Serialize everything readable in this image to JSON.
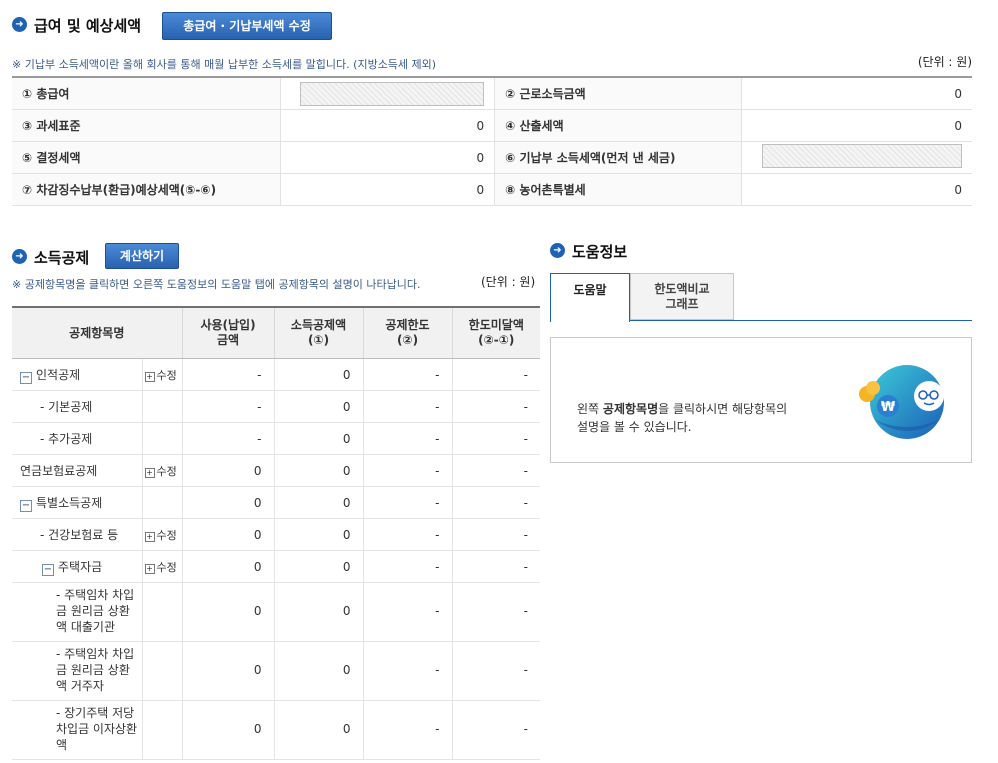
{
  "salary_section": {
    "title": "급여 및 예상세액",
    "edit_button": "총급여 · 기납부세액 수정",
    "note": "※ 기납부 소득세액이란 올해 회사를 통해 매월 납부한 소득세를 말힙니다. (지방소득세 제외)",
    "unit": "(단위 : 원)",
    "rows": [
      {
        "left_label": "① 총급여",
        "left_value": "",
        "right_label": "② 근로소득금액",
        "right_value": "0"
      },
      {
        "left_label": "③ 과세표준",
        "left_value": "0",
        "right_label": "④ 산출세액",
        "right_value": "0"
      },
      {
        "left_label": "⑤ 결정세액",
        "left_value": "0",
        "right_label": "⑥ 기납부 소득세액(먼저 낸 세금)",
        "right_value": ""
      },
      {
        "left_label": "⑦ 차감징수납부(환급)예상세액(⑤-⑥)",
        "left_value": "0",
        "right_label": "⑧ 농어촌특별세",
        "right_value": "0"
      }
    ]
  },
  "deduction_section": {
    "title": "소득공제",
    "calc_button": "계산하기",
    "note": "※ 공제항목명을 클릭하면 오른쪽 도움정보의 도움말 탭에 공제항목의 설명이 나타납니다.",
    "unit": "(단위 : 원)",
    "headers": [
      "공제항목명",
      "사용(납입)\n금액",
      "소득공제액\n(①)",
      "공제한도\n(②)",
      "한도미달액\n(②-①)"
    ],
    "edit_label": "수정",
    "rows": [
      {
        "name": "인적공제",
        "toggle": "−",
        "indent": 0,
        "edit": true,
        "use": "-",
        "ded": "0",
        "limit": "-",
        "short": "-"
      },
      {
        "name": "- 기본공제",
        "indent": 1,
        "edit": false,
        "use": "-",
        "ded": "0",
        "limit": "-",
        "short": "-"
      },
      {
        "name": "- 추가공제",
        "indent": 1,
        "edit": false,
        "use": "-",
        "ded": "0",
        "limit": "-",
        "short": "-"
      },
      {
        "name": "연금보험료공제",
        "indent": 0,
        "edit": true,
        "use": "0",
        "ded": "0",
        "limit": "-",
        "short": "-"
      },
      {
        "name": "특별소득공제",
        "toggle": "−",
        "indent": 0,
        "edit": false,
        "use": "0",
        "ded": "0",
        "limit": "-",
        "short": "-"
      },
      {
        "name": "- 건강보험료 등",
        "indent": 1,
        "edit": true,
        "use": "0",
        "ded": "0",
        "limit": "-",
        "short": "-"
      },
      {
        "name": "주택자금",
        "toggle": "−",
        "indent": 1,
        "edit": true,
        "use": "0",
        "ded": "0",
        "limit": "-",
        "short": "-"
      },
      {
        "name": "- 주택임차 차입금 원리금 상환액 대출기관",
        "indent": 2,
        "edit": false,
        "use": "0",
        "ded": "0",
        "limit": "-",
        "short": "-",
        "tall": true
      },
      {
        "name": "- 주택임차 차입금 원리금 상환액 거주자",
        "indent": 2,
        "edit": false,
        "use": "0",
        "ded": "0",
        "limit": "-",
        "short": "-",
        "tall": true
      },
      {
        "name": "- 장기주택 저당차입금 이자상환액",
        "indent": 2,
        "edit": false,
        "use": "0",
        "ded": "0",
        "limit": "-",
        "short": "-",
        "tall": true
      }
    ]
  },
  "help_section": {
    "title": "도움정보",
    "tabs": [
      "도움말",
      "한도액비교\n그래프"
    ],
    "help_text_prefix": "왼쪽 ",
    "help_text_bold": "공제항목명",
    "help_text_suffix": "을 클릭하시면 해당항목의",
    "help_text_line2": "설명을 볼 수 있습니다.",
    "icon": "won-coin-character-icon"
  },
  "colors": {
    "accent": "#1e62b4",
    "button": "#2862b0"
  }
}
